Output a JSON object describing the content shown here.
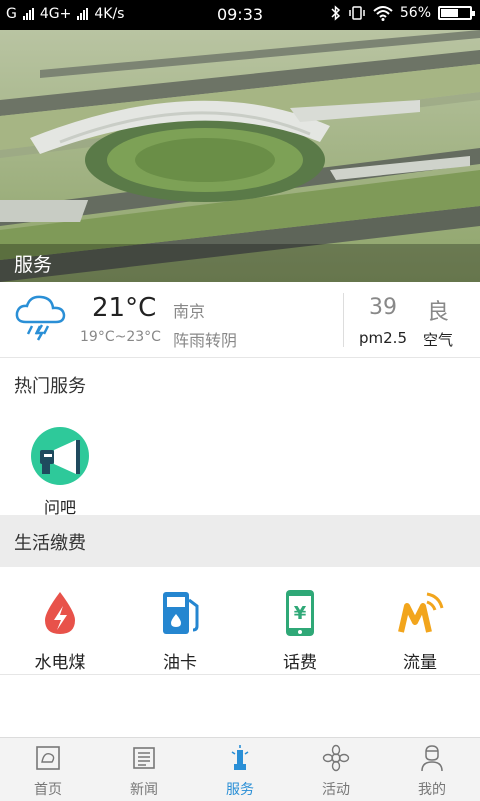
{
  "status_bar": {
    "carrier": "G",
    "network": "4G+",
    "speed": "4K/s",
    "time": "09:33",
    "battery": "56%",
    "battery_level": 0.56
  },
  "banner": {
    "caption": "服务"
  },
  "weather": {
    "icon": "thunderstorm-cloud-icon",
    "temperature": "21°C",
    "range": "19°C~23°C",
    "city": "南京",
    "condition": "阵雨转阴",
    "aqi_value": "39",
    "aqi_label": "pm2.5",
    "air_value": "良",
    "air_label": "空气"
  },
  "hot_services": {
    "title": "热门服务",
    "items": [
      {
        "label": "问吧",
        "icon": "megaphone-icon"
      }
    ]
  },
  "life_payment": {
    "title": "生活缴费",
    "items": [
      {
        "label": "水电煤",
        "icon": "water-drop-bolt-icon"
      },
      {
        "label": "油卡",
        "icon": "fuel-pump-icon"
      },
      {
        "label": "话费",
        "icon": "phone-yuan-icon"
      },
      {
        "label": "流量",
        "icon": "data-signal-icon"
      }
    ]
  },
  "tabs": [
    {
      "label": "首页",
      "icon": "home-icon"
    },
    {
      "label": "新闻",
      "icon": "newspaper-icon"
    },
    {
      "label": "服务",
      "icon": "tower-icon",
      "active": true
    },
    {
      "label": "活动",
      "icon": "flower-icon"
    },
    {
      "label": "我的",
      "icon": "person-icon"
    }
  ],
  "colors": {
    "accent": "#2a8fd6",
    "water": "#e8524a",
    "fuel": "#2586d0",
    "phone": "#2fa877",
    "data": "#f2a51c",
    "hot_icon_bg": "#2ec99a"
  }
}
